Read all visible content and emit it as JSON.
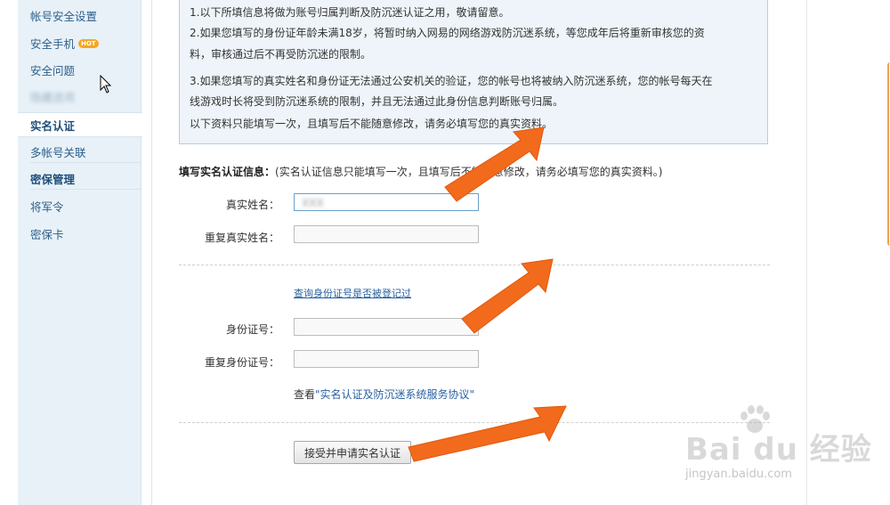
{
  "sidebar": {
    "items": [
      {
        "label": "帐号安全设置"
      },
      {
        "label": "安全手机",
        "badge": "HOT"
      },
      {
        "label": "安全问题"
      },
      {
        "label": "隐藏选项"
      },
      {
        "label": "实名认证"
      },
      {
        "label": "多帐号关联"
      },
      {
        "label": "密保管理"
      },
      {
        "label": "将军令"
      },
      {
        "label": "密保卡"
      }
    ]
  },
  "notice": {
    "lines": [
      "1.以下所填信息将做为账号归属判断及防沉迷认证之用，敬请留意。",
      "2.如果您填写的身份证年龄未满18岁，将暂时纳入网易的网络游戏防沉迷系统，等您成年后将重新审核您的资",
      "料，审核通过后不再受防沉迷的限制。",
      "3.如果您填写的真实姓名和身份证无法通过公安机关的验证，您的帐号也将被纳入防沉迷系统，您的帐号每天在",
      "线游戏时长将受到防沉迷系统的限制，并且无法通过此身份信息判断账号归属。",
      "以下资料只能填写一次，且填写后不能随意修改，请务必填写您的真实资料。"
    ]
  },
  "form": {
    "title": "填写实名认证信息：",
    "title_note": "(实名认证信息只能填写一次，且填写后不能随意修改，请务必填写您的真实资料。)",
    "real_name_label": "真实姓名：",
    "real_name_value": "XXX",
    "repeat_name_label": "重复真实姓名：",
    "check_id_link": "查询身份证号是否被登记过",
    "id_label": "身份证号：",
    "repeat_id_label": "重复身份证号：",
    "agreement_prefix": "查看",
    "agreement_link": "\"实名认证及防沉迷系统服务协议\"",
    "submit_label": "接受并申请实名认证"
  },
  "watermark": {
    "main": "Bai du 经验",
    "sub": "jingyan.baidu.com"
  },
  "colors": {
    "arrow": "#f26a1b",
    "sidebar_bg": "#e8f1f8",
    "notice_bg": "#eef4f9",
    "link": "#2860a0"
  }
}
